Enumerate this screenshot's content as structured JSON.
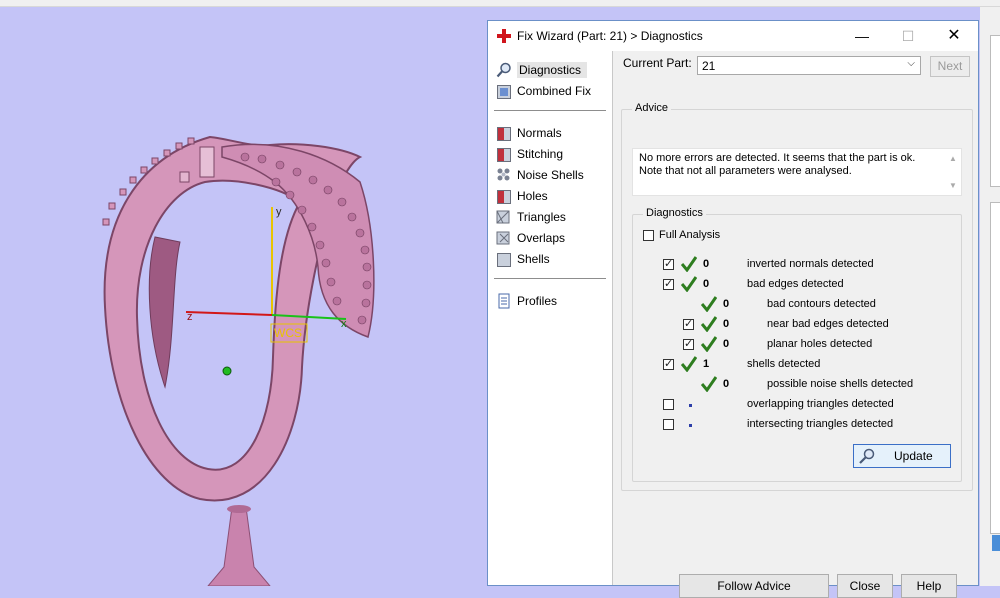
{
  "viewport": {
    "axis_y": "y",
    "axis_z": "z",
    "axis_x": "x",
    "wcs": "WCS"
  },
  "dialog": {
    "title": "Fix Wizard (Part: 21) > Diagnostics",
    "min_glyph": "—",
    "max_glyph": "☐",
    "close_glyph": "✕"
  },
  "nav": {
    "top": [
      {
        "label": "Diagnostics",
        "icon": "magnifier-icon"
      },
      {
        "label": "Combined Fix",
        "icon": "combined-fix-icon"
      }
    ],
    "fixes": [
      {
        "label": "Normals",
        "icon": "normals-icon"
      },
      {
        "label": "Stitching",
        "icon": "stitching-icon"
      },
      {
        "label": "Noise Shells",
        "icon": "noise-shells-icon"
      },
      {
        "label": "Holes",
        "icon": "holes-icon"
      },
      {
        "label": "Triangles",
        "icon": "triangles-icon"
      },
      {
        "label": "Overlaps",
        "icon": "overlaps-icon"
      },
      {
        "label": "Shells",
        "icon": "shells-icon"
      }
    ],
    "profiles": {
      "label": "Profiles",
      "icon": "profiles-icon"
    }
  },
  "current_part": {
    "label": "Current Part:",
    "value": "21",
    "next_label": "Next"
  },
  "advice": {
    "title": "Advice",
    "line1": "No more errors are detected. It seems that the part is ok.",
    "line2": "Note that not all parameters were analysed."
  },
  "diagnostics": {
    "title": "Diagnostics",
    "full_analysis": "Full Analysis",
    "rows": [
      {
        "checked": true,
        "status": "ok",
        "count": "0",
        "label": "inverted normals detected"
      },
      {
        "checked": true,
        "status": "ok",
        "count": "0",
        "label": "bad edges detected"
      },
      {
        "status": "ok",
        "count": "0",
        "label": "bad contours detected"
      },
      {
        "checked": true,
        "status": "ok",
        "count": "0",
        "label": "near bad edges detected"
      },
      {
        "checked": true,
        "status": "ok",
        "count": "0",
        "label": "planar holes detected"
      },
      {
        "checked": true,
        "status": "ok",
        "count": "1",
        "label": "shells detected"
      },
      {
        "status": "ok",
        "count": "0",
        "label": "possible noise shells detected"
      },
      {
        "checked": false,
        "status": "none",
        "label": "overlapping triangles detected"
      },
      {
        "checked": false,
        "status": "none",
        "label": "intersecting triangles detected"
      }
    ],
    "update_label": "Update"
  },
  "buttons": {
    "follow_advice": "Follow Advice",
    "close": "Close",
    "help": "Help"
  },
  "colors": {
    "viewport_bg": "#c4c4f7",
    "ring": "#d08fb3",
    "check_green": "#2e7d1f",
    "accent_blue": "#3b6fc7"
  }
}
